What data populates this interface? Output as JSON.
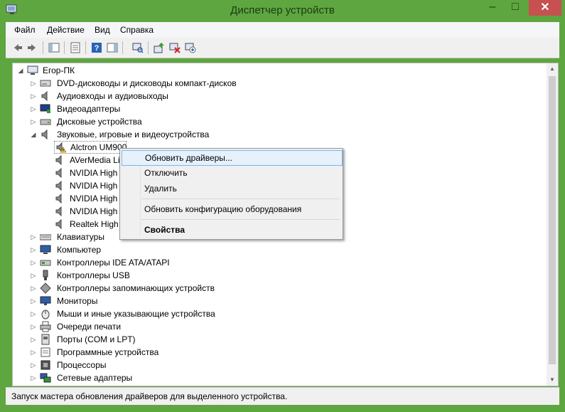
{
  "window": {
    "title": "Диспетчер устройств",
    "minimize": "–",
    "restore": "□",
    "close": "✕"
  },
  "menu": [
    "Файл",
    "Действие",
    "Вид",
    "Справка"
  ],
  "tree": {
    "root": "Егор-ПК",
    "categories_before": [
      "DVD-дисководы и дисководы компакт-дисков",
      "Аудиовходы и аудиовыходы",
      "Видеоадаптеры",
      "Дисковые устройства",
      "Звуковые, игровые и видеоустройства"
    ],
    "sound_devices": [
      "Alctron UM900",
      "AVerMedia Li",
      "NVIDIA High",
      "NVIDIA High",
      "NVIDIA High",
      "NVIDIA High",
      "Realtek High"
    ],
    "categories_after": [
      "Клавиатуры",
      "Компьютер",
      "Контроллеры IDE ATA/ATAPI",
      "Контроллеры USB",
      "Контроллеры запоминающих устройств",
      "Мониторы",
      "Мыши и иные указывающие устройства",
      "Очереди печати",
      "Порты (COM и LPT)",
      "Программные устройства",
      "Процессоры",
      "Сетевые адаптеры"
    ]
  },
  "context_menu": {
    "update_driver": "Обновить драйверы...",
    "disable": "Отключить",
    "uninstall": "Удалить",
    "scan_hardware": "Обновить конфигурацию оборудования",
    "properties": "Свойства"
  },
  "status": "Запуск мастера обновления драйверов для выделенного устройства.",
  "colors": {
    "accent": "#5ea63f",
    "close": "#c75050",
    "menu_highlight": "#e5f1fb"
  }
}
